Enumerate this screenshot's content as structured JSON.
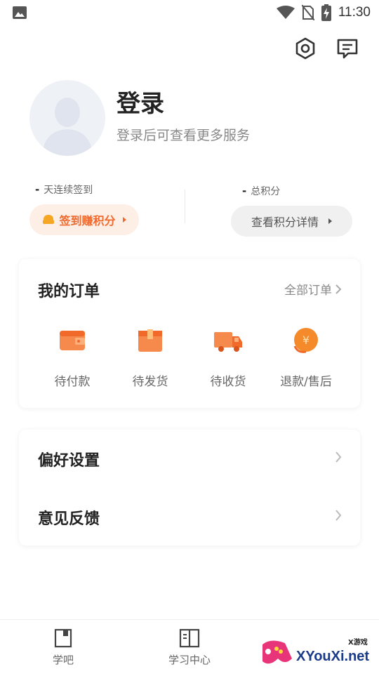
{
  "status_bar": {
    "time": "11:30"
  },
  "header": {
    "icons": [
      "settings-hexagon-icon",
      "message-icon"
    ]
  },
  "profile": {
    "title": "登录",
    "subtitle": "登录后可查看更多服务"
  },
  "checkin": {
    "streak_value": "-",
    "streak_label": "天连续签到",
    "button_label": "签到赚积分",
    "points_value": "-",
    "points_label": "总积分",
    "points_button": "查看积分详情"
  },
  "orders": {
    "title": "我的订单",
    "all_label": "全部订单",
    "items": [
      {
        "label": "待付款",
        "icon": "wallet-icon"
      },
      {
        "label": "待发货",
        "icon": "package-icon"
      },
      {
        "label": "待收货",
        "icon": "truck-icon"
      },
      {
        "label": "退款/售后",
        "icon": "refund-coin-icon"
      }
    ]
  },
  "settings": {
    "items": [
      {
        "label": "偏好设置"
      },
      {
        "label": "意见反馈"
      }
    ]
  },
  "bottom_nav": {
    "items": [
      {
        "label": "学吧",
        "icon": "book-icon"
      },
      {
        "label": "学习中心",
        "icon": "open-book-icon"
      }
    ]
  },
  "watermark": {
    "text": "XYouXi.net",
    "small": "X游戏"
  },
  "colors": {
    "accent": "#f06a2e",
    "accent_light": "#fdeee6",
    "text_dark": "#222222",
    "text_muted": "#888888"
  }
}
